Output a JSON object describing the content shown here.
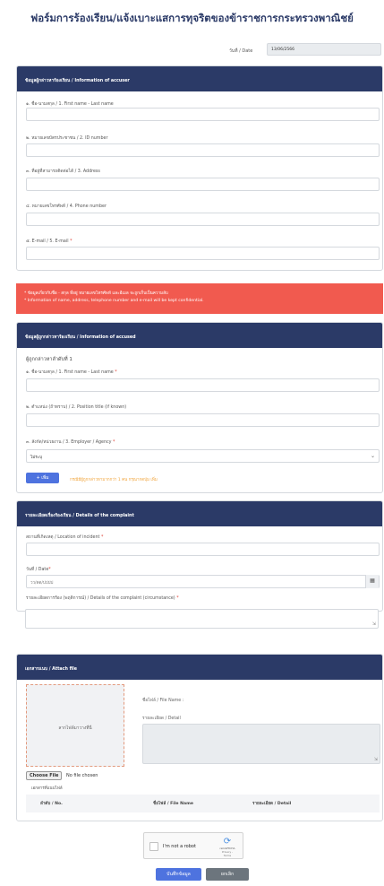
{
  "page": {
    "title": "ฟอร์มการร้องเรียน/แจ้งเบาะแสการทุจริตของข้าราชการกระทรวงพาณิชย์",
    "date_label": "วันที่ / Date",
    "date_value": "13/06/2566"
  },
  "accuser": {
    "header": "ข้อมูลผู้กล่าวหาร้องเรียน / Information of accuser",
    "name_label": "๑. ชื่อ-นามสกุล / 1. First name - Last name",
    "id_label": "๒. หมายเลขบัตรประชาชน / 2. ID number",
    "address_label": "๓. ที่อยู่ที่สามารถติดต่อได้ / 3. Address",
    "phone_label": "๔. หมายเลขโทรศัพท์ / 4. Phone number",
    "email_label": "๕. E-mail / 5. E-mail",
    "email_required": "*"
  },
  "alert": {
    "line1": "* ข้อมูลเกี่ยวกับชื่อ - สกุล ที่อยู่ หมายเลขโทรศัพท์ และอีเมล จะถูกเก็บเป็นความลับ",
    "line2": "* Information of name, address, telephone number and e-mail will be kept confidential."
  },
  "accused": {
    "header": "ข้อมูลผู้ถูกกล่าวหาร้องเรียน / Information of accused",
    "person_title": "ผู้ถูกกล่าวหาลำดับที่ 1",
    "name_label": "๑. ชื่อ-นามสกุล / 1. First name - Last name",
    "position_label": "๒. ตำแหน่ง (ถ้าทราบ) / 2. Position title (if known)",
    "agency_label": "๓. สังกัด/หน่วยงาน / 3. Employer / Agency",
    "agency_selected": "ไม่ระบุ",
    "required": "*",
    "add_button": "+ เพิ่ม",
    "add_note": "กรณีมีผู้ถูกกล่าวหามากกว่า 1 คน กรุณากดปุ่ม เพิ่ม"
  },
  "complaint": {
    "header": "รายละเอียดเรื่องร้องเรียน / Details of the complaint",
    "location_label": "สถานที่เกิดเหตุ / Location of incident",
    "date_label": "วันที่ / Date",
    "date_placeholder": "วว/ดด/ปปปป",
    "details_label": "รายละเอียดการร้อง (พฤติการณ์) / Details of the complaint (circumstance)",
    "required": "*"
  },
  "attach": {
    "header": "เอกสารแนบ / Attach file",
    "dropzone_text": "ลากไฟล์มาวางที่นี่",
    "filename_label": "ชื่อไฟล์ / File Name :",
    "detail_label": "รายละเอียด / Detail",
    "choose_button": "Choose File",
    "choose_status": "No file chosen",
    "docs_label": "เอกสารที่แนบไฟล์",
    "col_no": "ลำดับ / No.",
    "col_name": "ชื่อไฟล์ / File Name",
    "col_detail": "รายละเอียด / Detail"
  },
  "captcha": {
    "label": "I'm not a robot",
    "brand": "reCAPTCHA",
    "terms": "Privacy - Terms"
  },
  "actions": {
    "save": "บันทึกข้อมูล",
    "cancel": "ยกเลิก"
  },
  "colors": {
    "header_bg": "#2b3a67",
    "alert_bg": "#f15a4f",
    "primary": "#4e73df",
    "secondary": "#6c757d"
  }
}
